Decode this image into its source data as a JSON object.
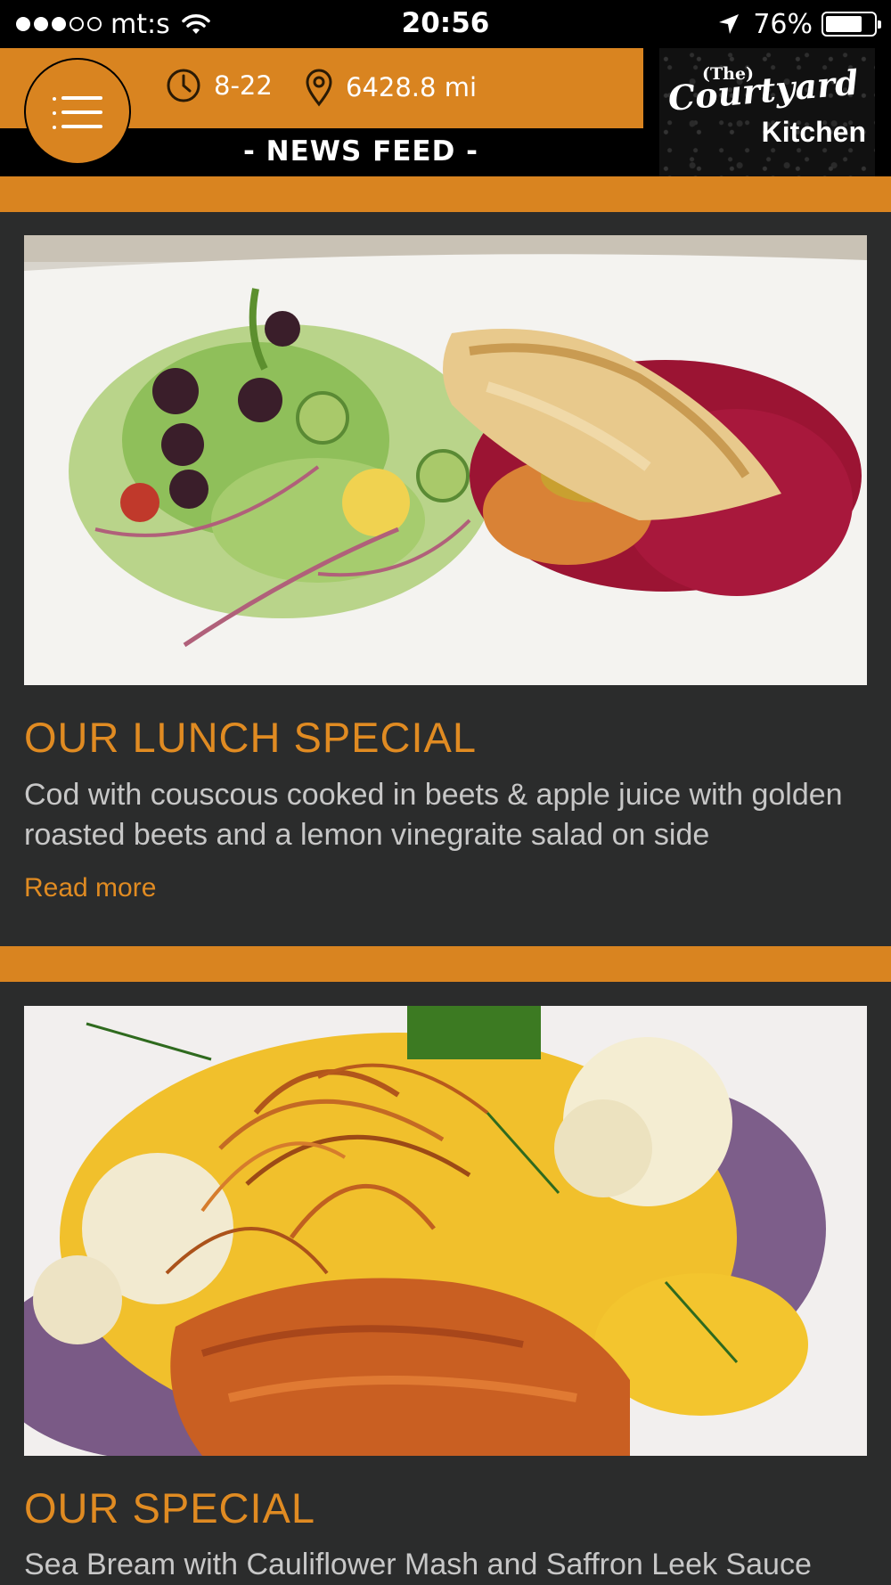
{
  "status_bar": {
    "carrier": "mt:s",
    "time": "20:56",
    "battery_percent": "76%",
    "battery_level": 0.76,
    "signal_bars_filled": 3,
    "signal_bars_total": 5
  },
  "header": {
    "hours": "8-22",
    "distance": "6428.8 mi",
    "section_title": "- NEWS FEED -",
    "logo": {
      "line1": "(The)",
      "line2": "Courtyard",
      "line3": "Kitchen"
    },
    "icons": {
      "menu": "hamburger-menu-icon",
      "hours": "clock-icon",
      "distance": "map-pin-icon"
    }
  },
  "colors": {
    "accent": "#d98420",
    "title": "#e08b22",
    "background": "#2b2c2c",
    "header_bg": "#000000",
    "text": "#c7c7c7"
  },
  "feed": [
    {
      "title": "OUR LUNCH SPECIAL",
      "description": "Cod with couscous cooked in beets & apple juice with golden roasted beets and a lemon vinegraite salad on side",
      "read_more": "Read more"
    },
    {
      "title": "OUR SPECIAL",
      "description": "Sea Bream with Cauliflower Mash and Saffron Leek Sauce"
    }
  ]
}
